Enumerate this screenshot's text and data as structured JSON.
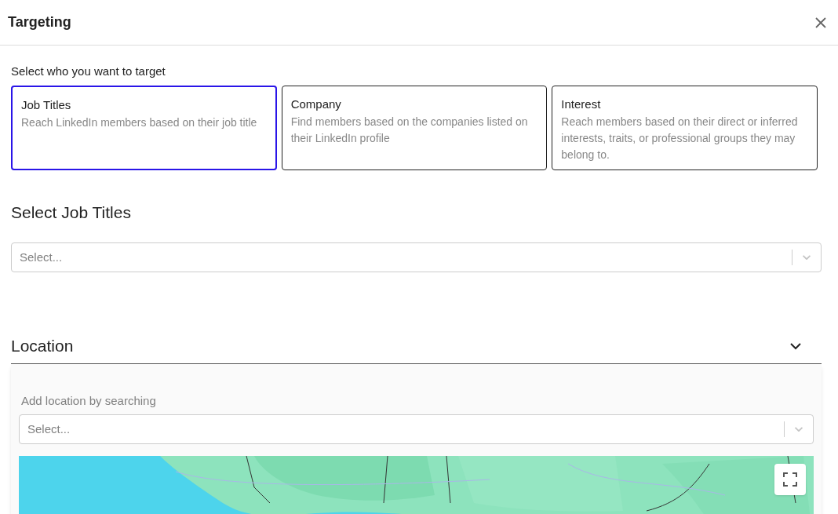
{
  "dialog": {
    "title": "Targeting"
  },
  "target_prompt": "Select who you want to target",
  "target_options": [
    {
      "title": "Job Titles",
      "description": "Reach LinkedIn members based on their job title",
      "selected": true
    },
    {
      "title": "Company",
      "description": "Find members based on the companies listed on their LinkedIn profile",
      "selected": false
    },
    {
      "title": "Interest",
      "description": "Reach members based on their direct or inferred interests, traits, or professional groups they may belong to.",
      "selected": false
    }
  ],
  "job_titles": {
    "heading": "Select Job Titles",
    "select": {
      "placeholder": "Select..."
    }
  },
  "location": {
    "heading": "Location",
    "expanded": true,
    "search_label": "Add location by searching",
    "select": {
      "placeholder": "Select..."
    }
  }
}
